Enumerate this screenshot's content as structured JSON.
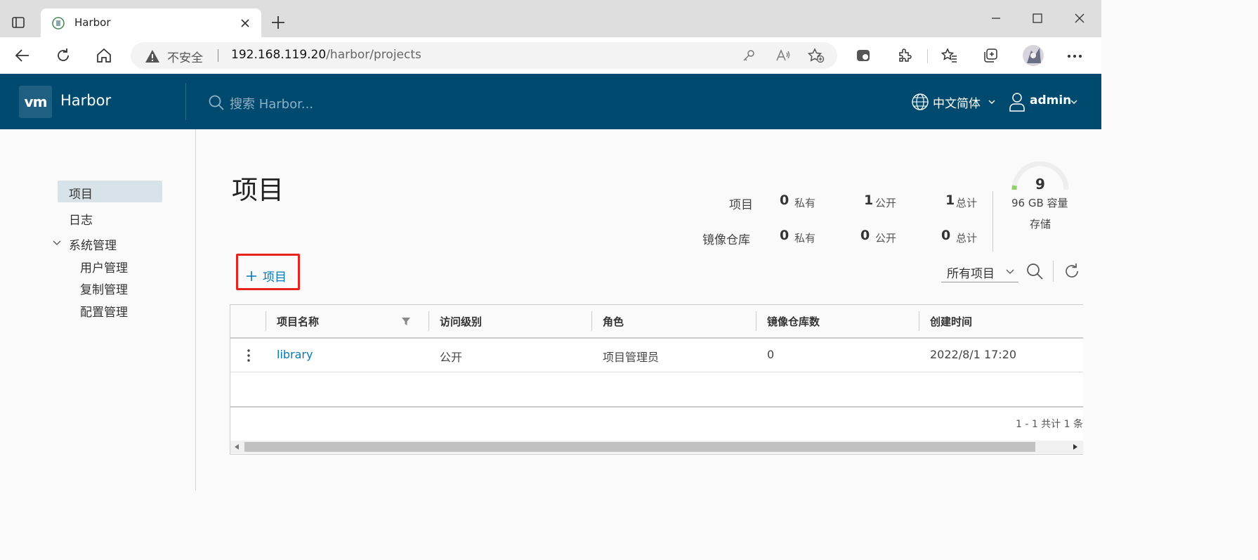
{
  "browser": {
    "tab_title": "Harbor",
    "url_warning": "不安全",
    "url_host": "192.168.119.20",
    "url_path": "/harbor/projects"
  },
  "header": {
    "logo_text": "vm",
    "brand": "Harbor",
    "search_placeholder": "搜索 Harbor...",
    "language": "中文简体",
    "user": "admin"
  },
  "sidebar": {
    "items": [
      {
        "label": "项目"
      },
      {
        "label": "日志"
      },
      {
        "label": "系统管理"
      }
    ],
    "admin_items": [
      {
        "label": "用户管理"
      },
      {
        "label": "复制管理"
      },
      {
        "label": "配置管理"
      }
    ]
  },
  "main": {
    "title": "项目",
    "stats": {
      "projects_label": "项目",
      "repos_label": "镜像仓库",
      "private_label": "私有",
      "public_label": "公开",
      "total_label": "总计",
      "projects": {
        "private": "0",
        "public": "1",
        "total": "1"
      },
      "repos": {
        "private": "0",
        "public": "0",
        "total": "0"
      }
    },
    "storage": {
      "count": "9",
      "capacity": "96 GB 容量",
      "label": "存储",
      "used_fraction": 0.05
    },
    "new_project_label": "项目",
    "filter_value": "所有项目",
    "table": {
      "columns": [
        "项目名称",
        "访问级别",
        "角色",
        "镜像仓库数",
        "创建时间"
      ],
      "rows": [
        {
          "name": "library",
          "access": "公开",
          "role": "项目管理员",
          "repo_count": "0",
          "created": "2022/8/1 17:20"
        }
      ],
      "pagination": "1 - 1 共计 1 条"
    }
  },
  "colors": {
    "header_bg": "#004a70",
    "link": "#0079b8",
    "highlight_frame": "#e8221c",
    "nav_active_bg": "#d8e3e9"
  }
}
